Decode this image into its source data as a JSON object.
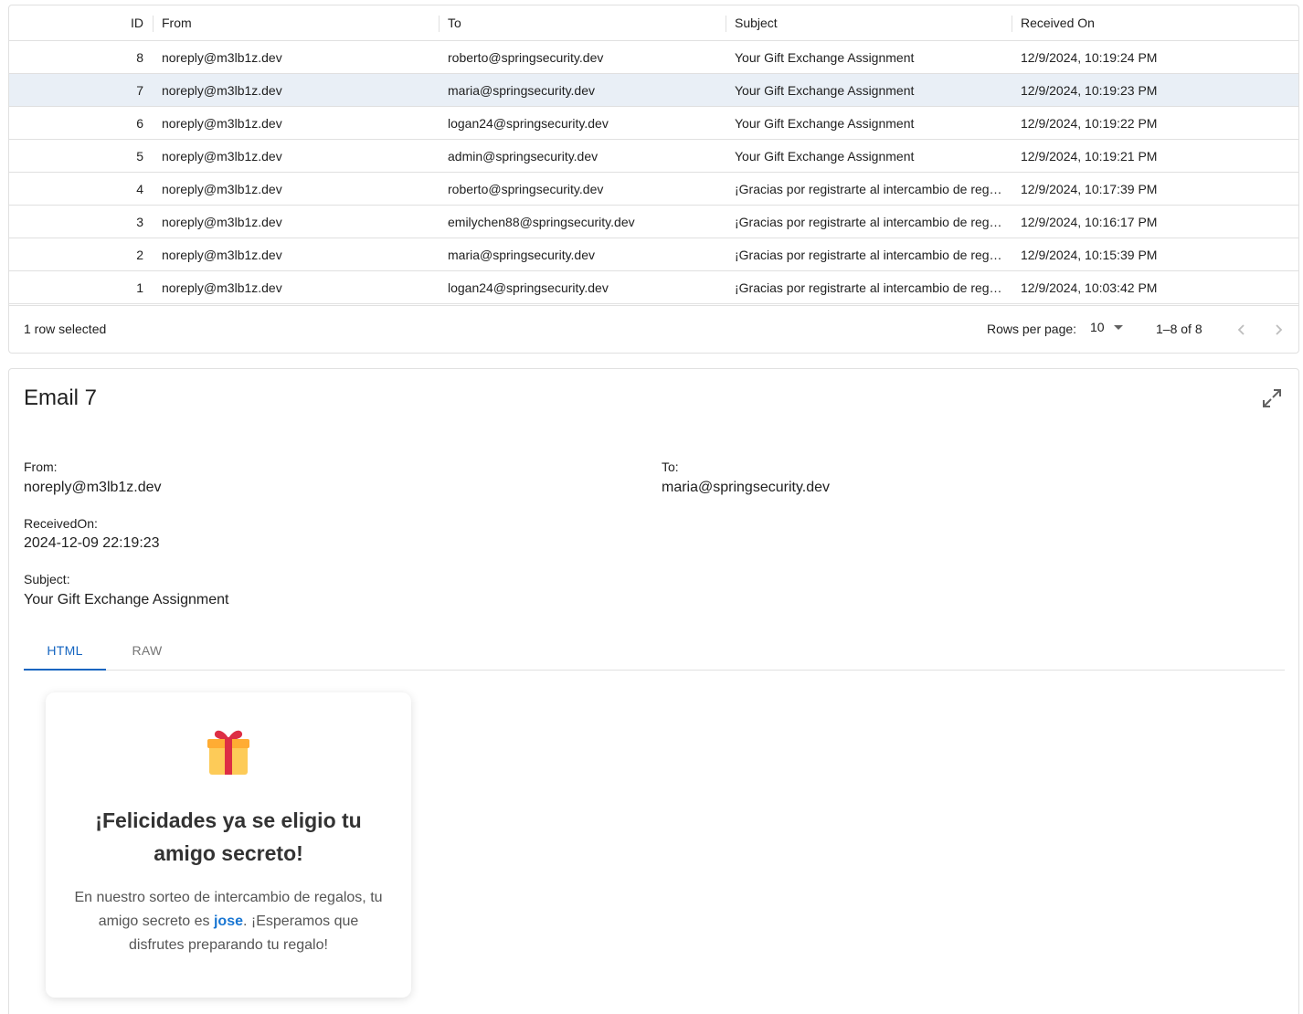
{
  "grid": {
    "columns": {
      "id": "ID",
      "from": "From",
      "to": "To",
      "subject": "Subject",
      "received": "Received On"
    },
    "rows": [
      {
        "id": "8",
        "from": "noreply@m3lb1z.dev",
        "to": "roberto@springsecurity.dev",
        "subject": "Your Gift Exchange Assignment",
        "received": "12/9/2024, 10:19:24 PM"
      },
      {
        "id": "7",
        "from": "noreply@m3lb1z.dev",
        "to": "maria@springsecurity.dev",
        "subject": "Your Gift Exchange Assignment",
        "received": "12/9/2024, 10:19:23 PM"
      },
      {
        "id": "6",
        "from": "noreply@m3lb1z.dev",
        "to": "logan24@springsecurity.dev",
        "subject": "Your Gift Exchange Assignment",
        "received": "12/9/2024, 10:19:22 PM"
      },
      {
        "id": "5",
        "from": "noreply@m3lb1z.dev",
        "to": "admin@springsecurity.dev",
        "subject": "Your Gift Exchange Assignment",
        "received": "12/9/2024, 10:19:21 PM"
      },
      {
        "id": "4",
        "from": "noreply@m3lb1z.dev",
        "to": "roberto@springsecurity.dev",
        "subject": "¡Gracias por registrarte al intercambio de reg…",
        "received": "12/9/2024, 10:17:39 PM"
      },
      {
        "id": "3",
        "from": "noreply@m3lb1z.dev",
        "to": "emilychen88@springsecurity.dev",
        "subject": "¡Gracias por registrarte al intercambio de reg…",
        "received": "12/9/2024, 10:16:17 PM"
      },
      {
        "id": "2",
        "from": "noreply@m3lb1z.dev",
        "to": "maria@springsecurity.dev",
        "subject": "¡Gracias por registrarte al intercambio de reg…",
        "received": "12/9/2024, 10:15:39 PM"
      },
      {
        "id": "1",
        "from": "noreply@m3lb1z.dev",
        "to": "logan24@springsecurity.dev",
        "subject": "¡Gracias por registrarte al intercambio de reg…",
        "received": "12/9/2024, 10:03:42 PM"
      }
    ],
    "selected_row_id": "7",
    "footer": {
      "selected_text": "1 row selected",
      "rows_per_page_label": "Rows per page:",
      "rows_per_page_value": "10",
      "page_range": "1–8 of 8"
    }
  },
  "detail": {
    "title": "Email 7",
    "from_label": "From:",
    "from_value": "noreply@m3lb1z.dev",
    "to_label": "To:",
    "to_value": "maria@springsecurity.dev",
    "received_label": "ReceivedOn:",
    "received_value": "2024-12-09 22:19:23",
    "subject_label": "Subject:",
    "subject_value": "Your Gift Exchange Assignment",
    "tabs": [
      "HTML",
      "RAW"
    ],
    "active_tab": "HTML"
  },
  "email_body": {
    "icon": "gift-icon",
    "heading": "¡Felicidades ya se eligio tu amigo secreto!",
    "text_before": "En nuestro sorteo de intercambio de regalos, tu amigo secreto es ",
    "friend_name": "jose",
    "text_after": ". ¡Esperamos que disfrutes preparando tu regalo!"
  },
  "colors": {
    "accent": "#1565c0",
    "selected_row": "#e9eff6",
    "link": "#1976d2",
    "gift_box": "#fdcb58",
    "gift_ribbon": "#dd2e44"
  }
}
